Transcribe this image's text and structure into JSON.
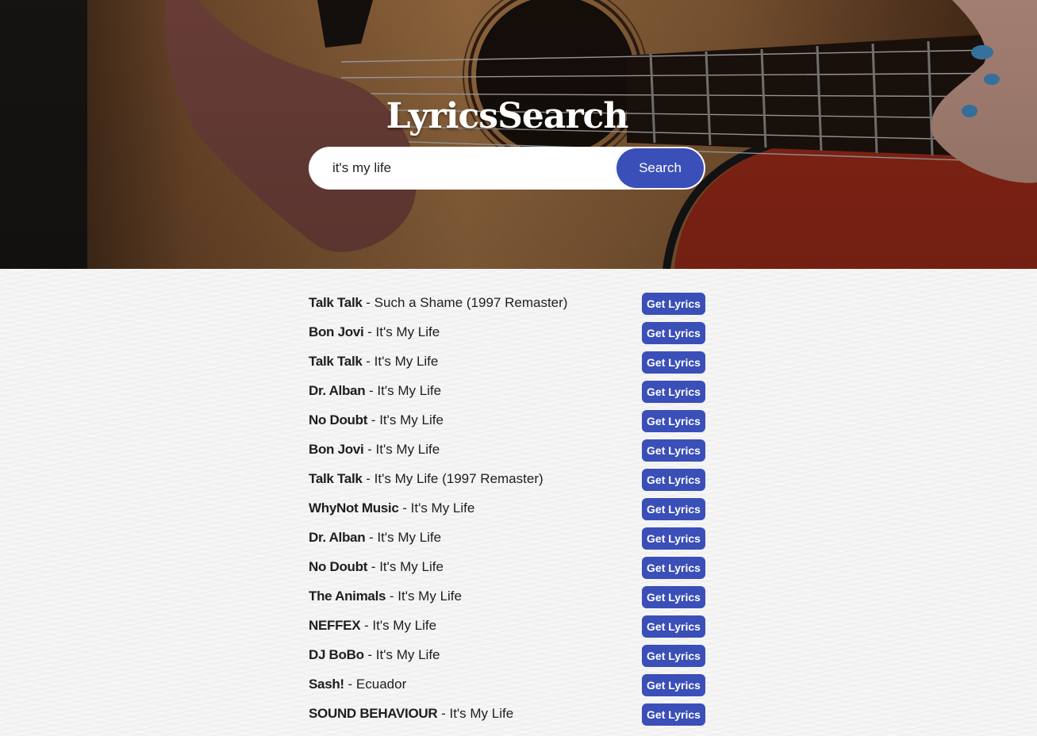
{
  "header": {
    "title": "LyricsSearch",
    "search_value": "it's my life",
    "search_button_label": "Search"
  },
  "colors": {
    "accent": "#3a4fb7",
    "page_bg": "#f4f4f4"
  },
  "separator": " - ",
  "results": [
    {
      "artist": "Talk Talk",
      "song": "Such a Shame (1997 Remaster)",
      "button": "Get Lyrics"
    },
    {
      "artist": "Bon Jovi",
      "song": "It's My Life",
      "button": "Get Lyrics"
    },
    {
      "artist": "Talk Talk",
      "song": "It's My Life",
      "button": "Get Lyrics"
    },
    {
      "artist": "Dr. Alban",
      "song": "It's My Life",
      "button": "Get Lyrics"
    },
    {
      "artist": "No Doubt",
      "song": "It's My Life",
      "button": "Get Lyrics"
    },
    {
      "artist": "Bon Jovi",
      "song": "It's My Life",
      "button": "Get Lyrics"
    },
    {
      "artist": "Talk Talk",
      "song": "It's My Life (1997 Remaster)",
      "button": "Get Lyrics"
    },
    {
      "artist": "WhyNot Music",
      "song": "It's My Life",
      "button": "Get Lyrics"
    },
    {
      "artist": "Dr. Alban",
      "song": "It's My Life",
      "button": "Get Lyrics"
    },
    {
      "artist": "No Doubt",
      "song": "It's My Life",
      "button": "Get Lyrics"
    },
    {
      "artist": "The Animals",
      "song": "It's My Life",
      "button": "Get Lyrics"
    },
    {
      "artist": "NEFFEX",
      "song": "It's My Life",
      "button": "Get Lyrics"
    },
    {
      "artist": "DJ BoBo",
      "song": "It's My Life",
      "button": "Get Lyrics"
    },
    {
      "artist": "Sash!",
      "song": "Ecuador",
      "button": "Get Lyrics"
    },
    {
      "artist": "SOUND BEHAVIOUR",
      "song": "It's My Life",
      "button": "Get Lyrics"
    }
  ]
}
